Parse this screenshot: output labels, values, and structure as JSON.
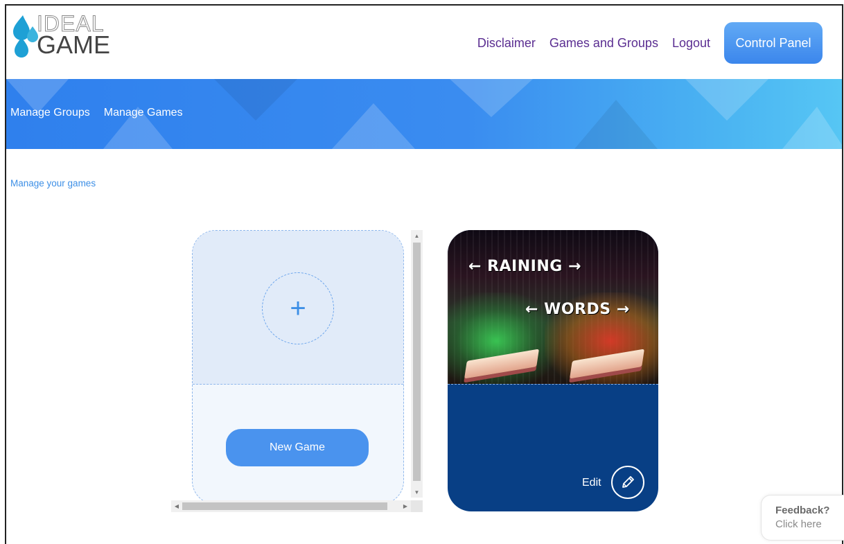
{
  "logo": {
    "line1": "IDEAL",
    "line2": "GAME",
    "colors": {
      "drop_primary": "#1ea0d5",
      "drop_secondary": "#3cb4de"
    }
  },
  "top_nav": {
    "items": [
      {
        "label": "Disclaimer"
      },
      {
        "label": "Games and Groups"
      },
      {
        "label": "Logout"
      }
    ],
    "control_panel": "Control Panel"
  },
  "banner": {
    "items": [
      {
        "label": "Manage Groups"
      },
      {
        "label": "Manage Games"
      }
    ]
  },
  "main": {
    "section_title": "Manage your games",
    "new_card": {
      "plus_symbol": "+",
      "button_label": "New Game"
    },
    "game_card": {
      "title_line1": "← RAINING →",
      "title_line2": "← WORDS →",
      "edit_label": "Edit"
    }
  },
  "scrollbars": {
    "up_arrow": "▲",
    "down_arrow": "▼",
    "left_arrow": "◀",
    "right_arrow": "▶"
  },
  "feedback": {
    "title": "Feedback?",
    "subtitle": "Click here"
  },
  "colors": {
    "accent_blue": "#3d8fe6",
    "nav_purple": "#5a2d91",
    "game_card_bg": "#083f85"
  }
}
